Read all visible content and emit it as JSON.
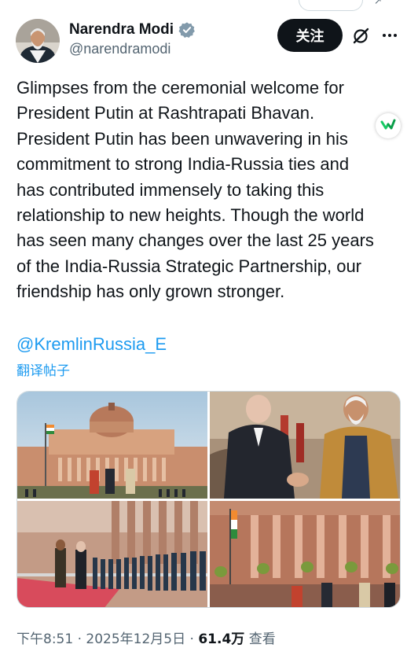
{
  "author": {
    "name": "Narendra Modi",
    "handle": "@narendramodi",
    "verified": true
  },
  "actions": {
    "follow_label": "关注"
  },
  "tweet": {
    "text": "Glimpses from the ceremonial welcome for\nPresident Putin at Rashtrapati Bhavan.\nPresident Putin has been unwavering in his\ncommitment to strong India-Russia ties and\nhas contributed immensely to taking this\nrelationship to new heights. Though the world\nhas seen many changes over the last 25 years\nof the India-Russia Strategic Partnership, our\nfriendship has only grown stronger.",
    "mention": "@KremlinRussia_E",
    "translate_label": "翻译帖子"
  },
  "media": [
    {
      "name": "rashtrapati-bhavan-dome-photo"
    },
    {
      "name": "putin-modi-handshake-photo"
    },
    {
      "name": "guard-of-honour-photo"
    },
    {
      "name": "colonnade-welcome-photo"
    }
  ],
  "meta": {
    "time": "下午8:51",
    "separator1": " · ",
    "date": "2025年12月5日",
    "separator2": " · ",
    "views": "61.4万",
    "views_label": " 查看"
  },
  "colors": {
    "accent": "#1d9bf0",
    "text": "#0f1419",
    "secondary": "#536471",
    "follow_bg": "#0f1419"
  },
  "icons": [
    "verified-badge-icon",
    "grok-icon",
    "more-icon",
    "translate-check-icon"
  ]
}
